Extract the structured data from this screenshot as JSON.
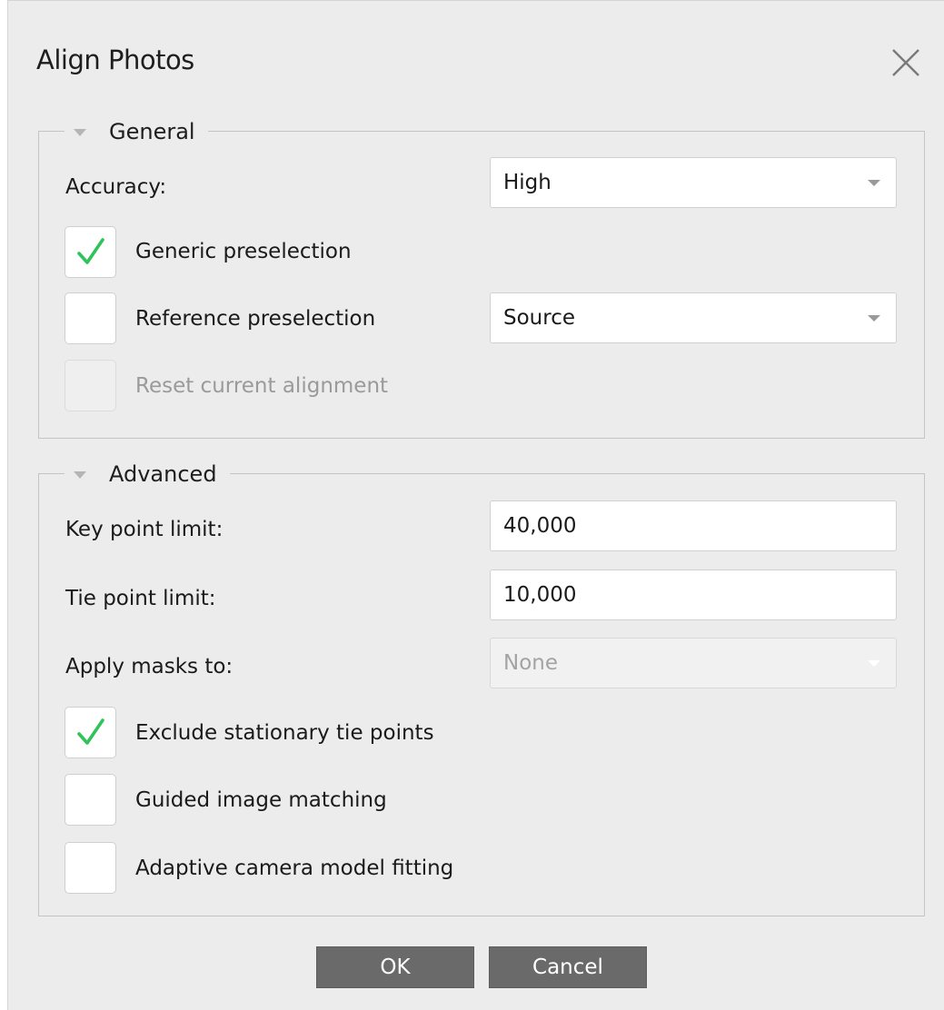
{
  "dialog": {
    "title": "Align Photos",
    "close_icon": "close-icon"
  },
  "general": {
    "legend": "General",
    "accuracy_label": "Accuracy:",
    "accuracy_value": "High",
    "generic_preselection_label": "Generic preselection",
    "generic_preselection_checked": true,
    "reference_preselection_label": "Reference preselection",
    "reference_preselection_checked": false,
    "reference_value": "Source",
    "reset_alignment_label": "Reset current alignment",
    "reset_alignment_checked": false,
    "reset_alignment_enabled": false
  },
  "advanced": {
    "legend": "Advanced",
    "key_point_label": "Key point limit:",
    "key_point_value": "40,000",
    "tie_point_label": "Tie point limit:",
    "tie_point_value": "10,000",
    "apply_masks_label": "Apply masks to:",
    "apply_masks_value": "None",
    "apply_masks_enabled": false,
    "exclude_stationary_label": "Exclude stationary tie points",
    "exclude_stationary_checked": true,
    "guided_matching_label": "Guided image matching",
    "guided_matching_checked": false,
    "adaptive_fitting_label": "Adaptive camera model fitting",
    "adaptive_fitting_checked": false
  },
  "buttons": {
    "ok": "OK",
    "cancel": "Cancel"
  },
  "colors": {
    "check_accent": "#2fc35a",
    "button_bg": "#6a6a6a",
    "dialog_bg": "#ececec"
  }
}
